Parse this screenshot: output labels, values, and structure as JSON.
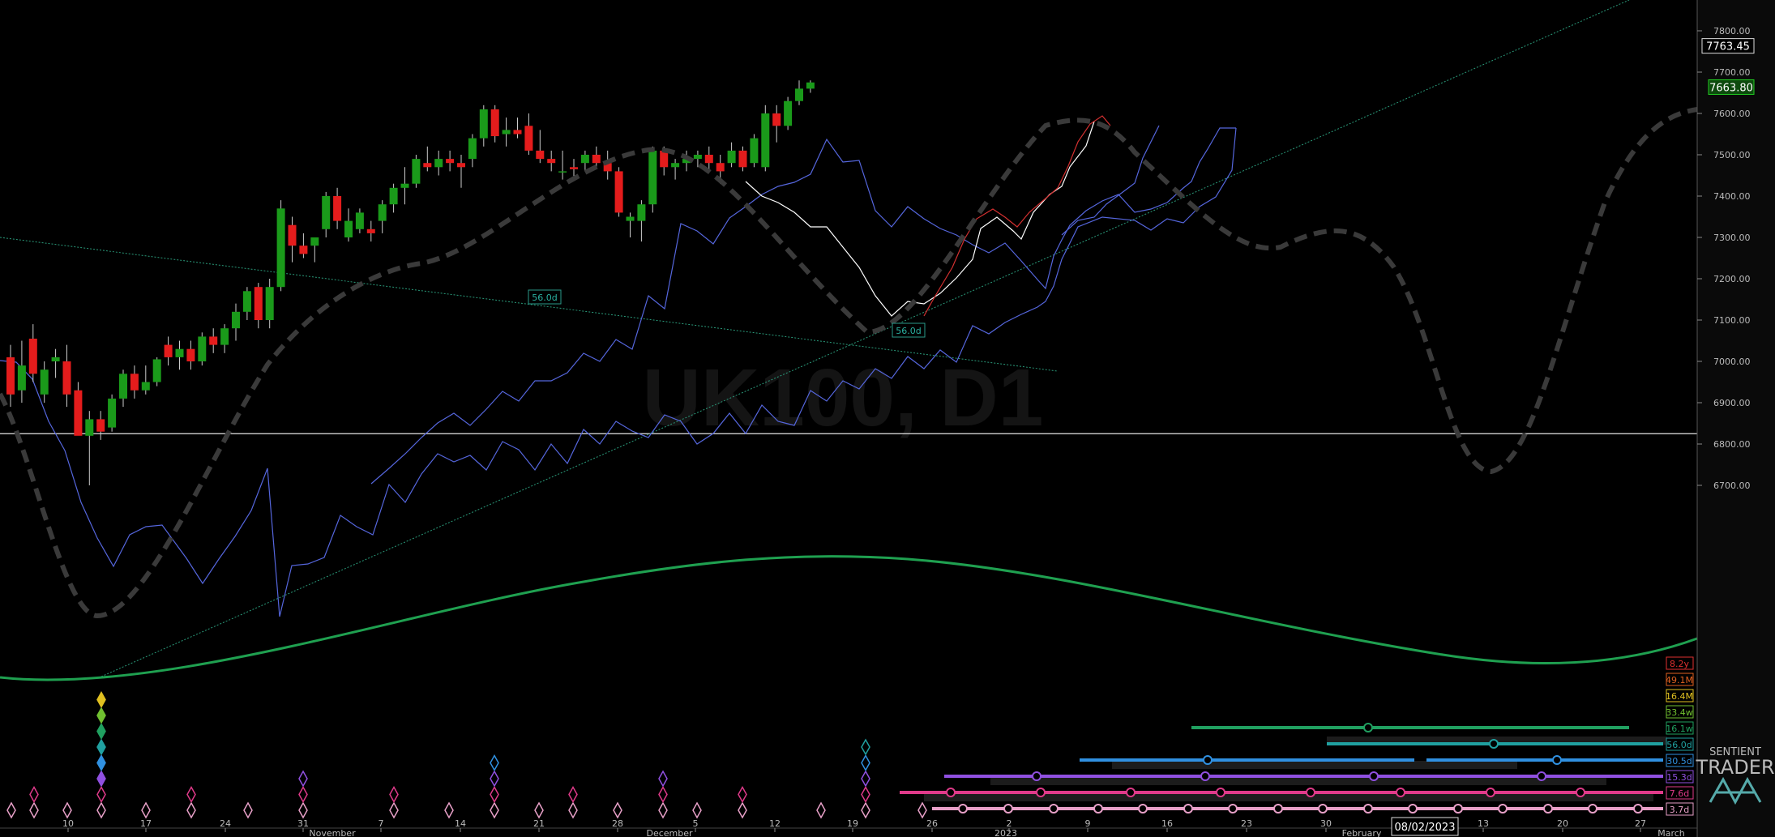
{
  "chart_data": {
    "type": "candlestick",
    "instrument_watermark": "UK100, D1",
    "y_axis": {
      "range": [
        6640,
        7840
      ],
      "ticks": [
        "7800.00",
        "7700.00",
        "7600.00",
        "7500.00",
        "7400.00",
        "7300.00",
        "7200.00",
        "7100.00",
        "7000.00",
        "6900.00",
        "6800.00",
        "6700.00"
      ],
      "tick_values": [
        7800,
        7700,
        7600,
        7500,
        7400,
        7300,
        7200,
        7100,
        7000,
        6900,
        6800,
        6700
      ]
    },
    "price_labels": [
      {
        "text": "7763.45",
        "value": 7763.45,
        "color": "#ffffff"
      },
      {
        "text": "7663.80",
        "value": 7663.8,
        "color": "#22cc22"
      }
    ],
    "horizontal_line": {
      "value": 6825
    },
    "x_axis": {
      "day_ticks": [
        "10",
        "17",
        "24",
        "31",
        "7",
        "14",
        "21",
        "28",
        "5",
        "12",
        "19",
        "26",
        "2",
        "9",
        "16",
        "23",
        "30",
        "13",
        "20",
        "27"
      ],
      "month_ticks": [
        "November",
        "December",
        "2023",
        "February",
        "March"
      ],
      "cursor_date": "08/02/2023"
    },
    "candles": [
      {
        "o": 7010,
        "h": 7040,
        "l": 6890,
        "c": 6920
      },
      {
        "o": 6930,
        "h": 7050,
        "l": 6900,
        "c": 6990
      },
      {
        "o": 7055,
        "h": 7090,
        "l": 6950,
        "c": 6970
      },
      {
        "o": 6920,
        "h": 7000,
        "l": 6900,
        "c": 6980
      },
      {
        "o": 7000,
        "h": 7030,
        "l": 6960,
        "c": 7010
      },
      {
        "o": 7000,
        "h": 7040,
        "l": 6890,
        "c": 6920
      },
      {
        "o": 6930,
        "h": 6950,
        "l": 6840,
        "c": 6820
      },
      {
        "o": 6820,
        "h": 6880,
        "l": 6700,
        "c": 6860
      },
      {
        "o": 6860,
        "h": 6880,
        "l": 6810,
        "c": 6830
      },
      {
        "o": 6840,
        "h": 6920,
        "l": 6830,
        "c": 6910
      },
      {
        "o": 6910,
        "h": 6980,
        "l": 6890,
        "c": 6970
      },
      {
        "o": 6970,
        "h": 6990,
        "l": 6910,
        "c": 6930
      },
      {
        "o": 6930,
        "h": 6990,
        "l": 6920,
        "c": 6950
      },
      {
        "o": 6950,
        "h": 7010,
        "l": 6940,
        "c": 7005
      },
      {
        "o": 7040,
        "h": 7060,
        "l": 6990,
        "c": 7010
      },
      {
        "o": 7010,
        "h": 7050,
        "l": 6980,
        "c": 7030
      },
      {
        "o": 7030,
        "h": 7050,
        "l": 6980,
        "c": 7000
      },
      {
        "o": 7000,
        "h": 7070,
        "l": 6990,
        "c": 7060
      },
      {
        "o": 7060,
        "h": 7080,
        "l": 7020,
        "c": 7040
      },
      {
        "o": 7040,
        "h": 7090,
        "l": 7020,
        "c": 7080
      },
      {
        "o": 7080,
        "h": 7140,
        "l": 7050,
        "c": 7120
      },
      {
        "o": 7120,
        "h": 7180,
        "l": 7100,
        "c": 7170
      },
      {
        "o": 7180,
        "h": 7190,
        "l": 7080,
        "c": 7100
      },
      {
        "o": 7100,
        "h": 7200,
        "l": 7080,
        "c": 7180
      },
      {
        "o": 7180,
        "h": 7390,
        "l": 7170,
        "c": 7370
      },
      {
        "o": 7330,
        "h": 7350,
        "l": 7240,
        "c": 7280
      },
      {
        "o": 7280,
        "h": 7310,
        "l": 7250,
        "c": 7260
      },
      {
        "o": 7280,
        "h": 7300,
        "l": 7240,
        "c": 7300
      },
      {
        "o": 7320,
        "h": 7410,
        "l": 7300,
        "c": 7400
      },
      {
        "o": 7400,
        "h": 7420,
        "l": 7320,
        "c": 7340
      },
      {
        "o": 7300,
        "h": 7370,
        "l": 7290,
        "c": 7340
      },
      {
        "o": 7320,
        "h": 7370,
        "l": 7310,
        "c": 7360
      },
      {
        "o": 7320,
        "h": 7340,
        "l": 7290,
        "c": 7310
      },
      {
        "o": 7340,
        "h": 7390,
        "l": 7310,
        "c": 7380
      },
      {
        "o": 7380,
        "h": 7430,
        "l": 7360,
        "c": 7420
      },
      {
        "o": 7420,
        "h": 7470,
        "l": 7380,
        "c": 7430
      },
      {
        "o": 7430,
        "h": 7500,
        "l": 7420,
        "c": 7490
      },
      {
        "o": 7480,
        "h": 7520,
        "l": 7460,
        "c": 7470
      },
      {
        "o": 7470,
        "h": 7510,
        "l": 7450,
        "c": 7490
      },
      {
        "o": 7490,
        "h": 7510,
        "l": 7460,
        "c": 7480
      },
      {
        "o": 7480,
        "h": 7500,
        "l": 7420,
        "c": 7470
      },
      {
        "o": 7490,
        "h": 7550,
        "l": 7470,
        "c": 7540
      },
      {
        "o": 7540,
        "h": 7620,
        "l": 7520,
        "c": 7610
      },
      {
        "o": 7610,
        "h": 7620,
        "l": 7530,
        "c": 7545
      },
      {
        "o": 7550,
        "h": 7590,
        "l": 7520,
        "c": 7560
      },
      {
        "o": 7560,
        "h": 7590,
        "l": 7540,
        "c": 7550
      },
      {
        "o": 7570,
        "h": 7600,
        "l": 7500,
        "c": 7510
      },
      {
        "o": 7510,
        "h": 7560,
        "l": 7480,
        "c": 7490
      },
      {
        "o": 7490,
        "h": 7510,
        "l": 7460,
        "c": 7480
      },
      {
        "o": 7460,
        "h": 7510,
        "l": 7440,
        "c": 7460
      },
      {
        "o": 7470,
        "h": 7490,
        "l": 7440,
        "c": 7465
      },
      {
        "o": 7480,
        "h": 7510,
        "l": 7460,
        "c": 7500
      },
      {
        "o": 7500,
        "h": 7520,
        "l": 7470,
        "c": 7480
      },
      {
        "o": 7480,
        "h": 7510,
        "l": 7440,
        "c": 7460
      },
      {
        "o": 7460,
        "h": 7470,
        "l": 7350,
        "c": 7360
      },
      {
        "o": 7340,
        "h": 7360,
        "l": 7300,
        "c": 7350
      },
      {
        "o": 7340,
        "h": 7390,
        "l": 7290,
        "c": 7380
      },
      {
        "o": 7380,
        "h": 7520,
        "l": 7360,
        "c": 7510
      },
      {
        "o": 7510,
        "h": 7520,
        "l": 7450,
        "c": 7470
      },
      {
        "o": 7470,
        "h": 7490,
        "l": 7440,
        "c": 7480
      },
      {
        "o": 7480,
        "h": 7510,
        "l": 7460,
        "c": 7490
      },
      {
        "o": 7490,
        "h": 7510,
        "l": 7470,
        "c": 7500
      },
      {
        "o": 7500,
        "h": 7520,
        "l": 7460,
        "c": 7480
      },
      {
        "o": 7480,
        "h": 7500,
        "l": 7430,
        "c": 7460
      },
      {
        "o": 7480,
        "h": 7530,
        "l": 7470,
        "c": 7510
      },
      {
        "o": 7510,
        "h": 7520,
        "l": 7460,
        "c": 7470
      },
      {
        "o": 7480,
        "h": 7550,
        "l": 7470,
        "c": 7540
      },
      {
        "o": 7470,
        "h": 7620,
        "l": 7460,
        "c": 7600
      },
      {
        "o": 7600,
        "h": 7620,
        "l": 7530,
        "c": 7570
      },
      {
        "o": 7570,
        "h": 7640,
        "l": 7560,
        "c": 7630
      },
      {
        "o": 7630,
        "h": 7680,
        "l": 7620,
        "c": 7660
      },
      {
        "o": 7660,
        "h": 7680,
        "l": 7650,
        "c": 7675
      }
    ],
    "cycle_labels_on_chart": [
      "56.0d",
      "56.0d"
    ],
    "cycle_periods": [
      {
        "text": "8.2y",
        "color": "#e03030"
      },
      {
        "text": "49.1M",
        "color": "#e06020"
      },
      {
        "text": "16.4M",
        "color": "#e0c020"
      },
      {
        "text": "33.4w",
        "color": "#70c030"
      },
      {
        "text": "16.1w",
        "color": "#20a060"
      },
      {
        "text": "56.0d",
        "color": "#20a0a0"
      },
      {
        "text": "30.5d",
        "color": "#3090e0"
      },
      {
        "text": "15.3d",
        "color": "#9050e0"
      },
      {
        "text": "7.6d",
        "color": "#e03a8a"
      },
      {
        "text": "3.7d",
        "color": "#e8a0c8"
      }
    ],
    "logo": {
      "line1": "SENTIENT",
      "line2": "TRADER"
    }
  }
}
